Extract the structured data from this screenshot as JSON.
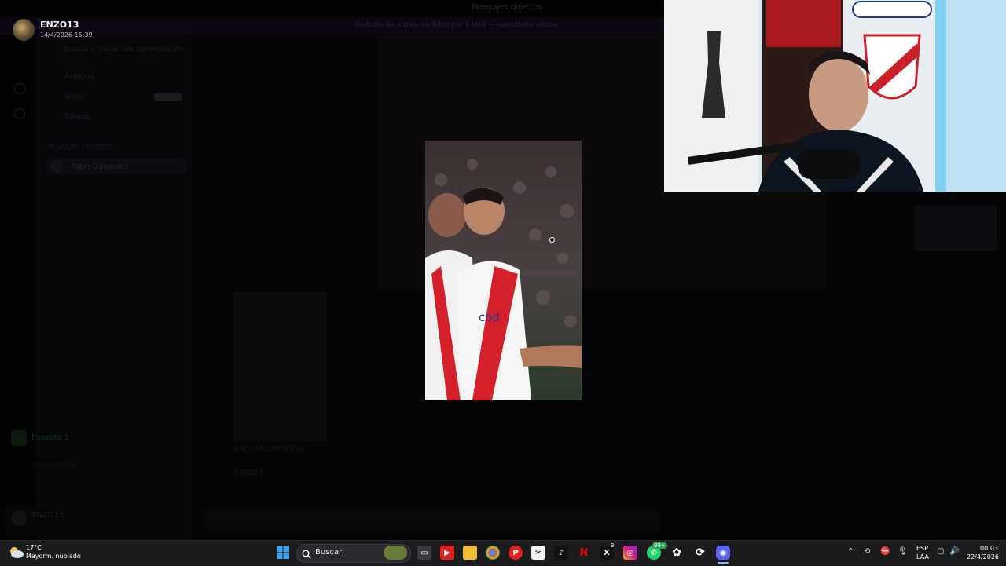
{
  "topbar": {
    "title": "Mensajes directos"
  },
  "promo": {
    "text": "Disfruta de 1 mes de Nitro por 1 US$ — suscríbete ahora"
  },
  "sidebar": {
    "search_placeholder": "Buscar o iniciar una conversación",
    "items": [
      {
        "label": "Amigos"
      },
      {
        "label": "Nitro"
      },
      {
        "label": "Tienda"
      }
    ],
    "nitro_badge": "",
    "dm_heading": "MENSAJES DIRECTOS",
    "dm_item": "Fabri Gonzalez"
  },
  "voice": {
    "label": "Pasaste 1",
    "sub": "Voz conectada"
  },
  "user": {
    "name": "ENZO13"
  },
  "viewer": {
    "author": "ENZO13",
    "timestamp": "14/4/2026 15:39"
  },
  "chat": {
    "message_author": "ENZO13",
    "media_caption": "ARQUERO RESERVA"
  },
  "taskbar": {
    "weather_temp": "17°C",
    "weather_desc": "Mayorm. nublado",
    "search_label": "Buscar",
    "lang1": "ESP",
    "lang2": "LAA",
    "time": "00:03",
    "date": "22/4/2026",
    "x_badge": "3",
    "whatsapp_badge": "99+"
  },
  "icons": [
    "windows-start-icon",
    "search-icon",
    "file-explorer-icon",
    "youtube-icon",
    "folder-icon",
    "chrome-icon",
    "pinterest-icon",
    "capcut-icon",
    "tiktok-icon",
    "netflix-icon",
    "x-icon",
    "instagram-icon",
    "whatsapp-icon",
    "chatgpt-icon",
    "app-icon",
    "discord-icon"
  ]
}
